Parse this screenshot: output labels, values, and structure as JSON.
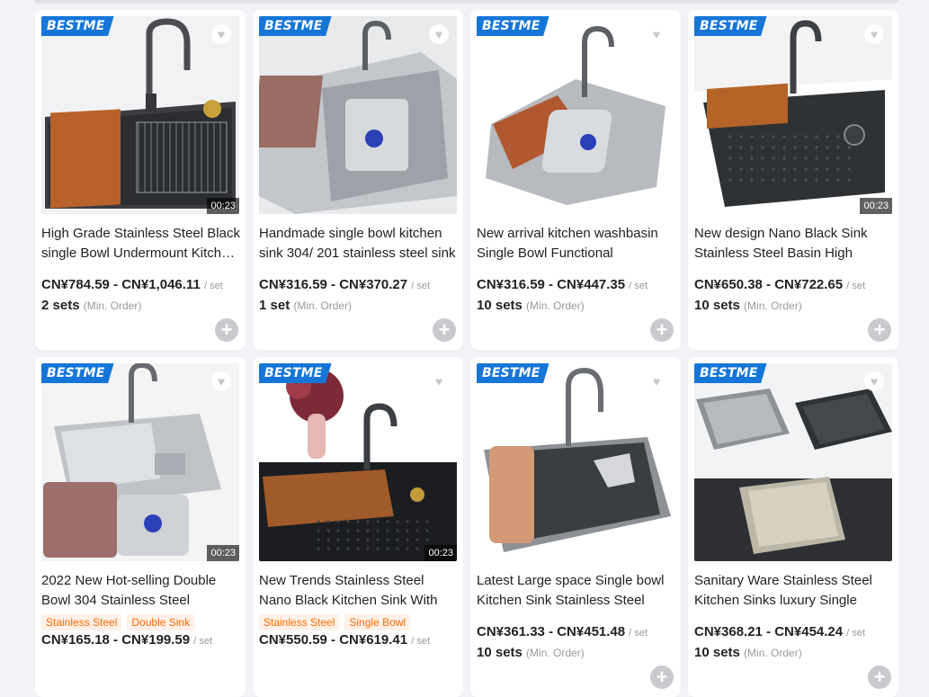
{
  "products": [
    {
      "brand": "BESTME",
      "title": "High Grade Stainless Steel Black single Bowl Undermount Kitchen Sink",
      "price_range": "CN¥784.59 - CN¥1,046.11",
      "unit": "/ set",
      "moq": "2 sets",
      "moq_suffix": "(Min. Order)",
      "video": "00:23",
      "tags": [],
      "style": "dark-cutting"
    },
    {
      "brand": "BESTME",
      "title": "Handmade single bowl kitchen sink 304/ 201 stainless steel sink",
      "price_range": "CN¥316.59 - CN¥370.27",
      "unit": "/ set",
      "moq": "1 set",
      "moq_suffix": "(Min. Order)",
      "video": "",
      "tags": [],
      "style": "steel-board"
    },
    {
      "brand": "BESTME",
      "title": "New arrival kitchen washbasin Single Bowl Functional",
      "price_range": "CN¥316.59 - CN¥447.35",
      "unit": "/ set",
      "moq": "10 sets",
      "moq_suffix": "(Min. Order)",
      "video": "",
      "tags": [],
      "style": "steel-wood"
    },
    {
      "brand": "BESTME",
      "title": "New design Nano Black Sink Stainless Steel Basin High",
      "price_range": "CN¥650.38 - CN¥722.65",
      "unit": "/ set",
      "moq": "10 sets",
      "moq_suffix": "(Min. Order)",
      "video": "00:23",
      "tags": [],
      "style": "dark-counter"
    },
    {
      "brand": "BESTME",
      "title": "2022 New Hot-selling Double Bowl 304 Stainless Steel",
      "price_range": "CN¥165.18 - CN¥199.59",
      "unit": "/ set",
      "moq": "",
      "moq_suffix": "",
      "video": "00:23",
      "tags": [
        "Stainless Steel",
        "Double Sink"
      ],
      "style": "steel-double"
    },
    {
      "brand": "BESTME",
      "title": "New Trends Stainless Steel Nano Black Kitchen Sink With",
      "price_range": "CN¥550.59 - CN¥619.41",
      "unit": "/ set",
      "moq": "",
      "moq_suffix": "",
      "video": "00:23",
      "tags": [
        "Stainless Steel",
        "Single Bowl"
      ],
      "style": "dark-flowers"
    },
    {
      "brand": "BESTME",
      "title": "Latest Large space Single bowl Kitchen Sink Stainless Steel",
      "price_range": "CN¥361.33 - CN¥451.48",
      "unit": "/ set",
      "moq": "10 sets",
      "moq_suffix": "(Min. Order)",
      "video": "",
      "tags": [],
      "style": "dark-board"
    },
    {
      "brand": "BESTME",
      "title": "Sanitary Ware Stainless Steel Kitchen Sinks luxury Single",
      "price_range": "CN¥368.21 - CN¥454.24",
      "unit": "/ set",
      "moq": "10 sets",
      "moq_suffix": "(Min. Order)",
      "video": "",
      "tags": [],
      "style": "three-sinks"
    }
  ],
  "icons": {
    "favorite": "heart-icon",
    "add": "plus-circle-icon"
  }
}
